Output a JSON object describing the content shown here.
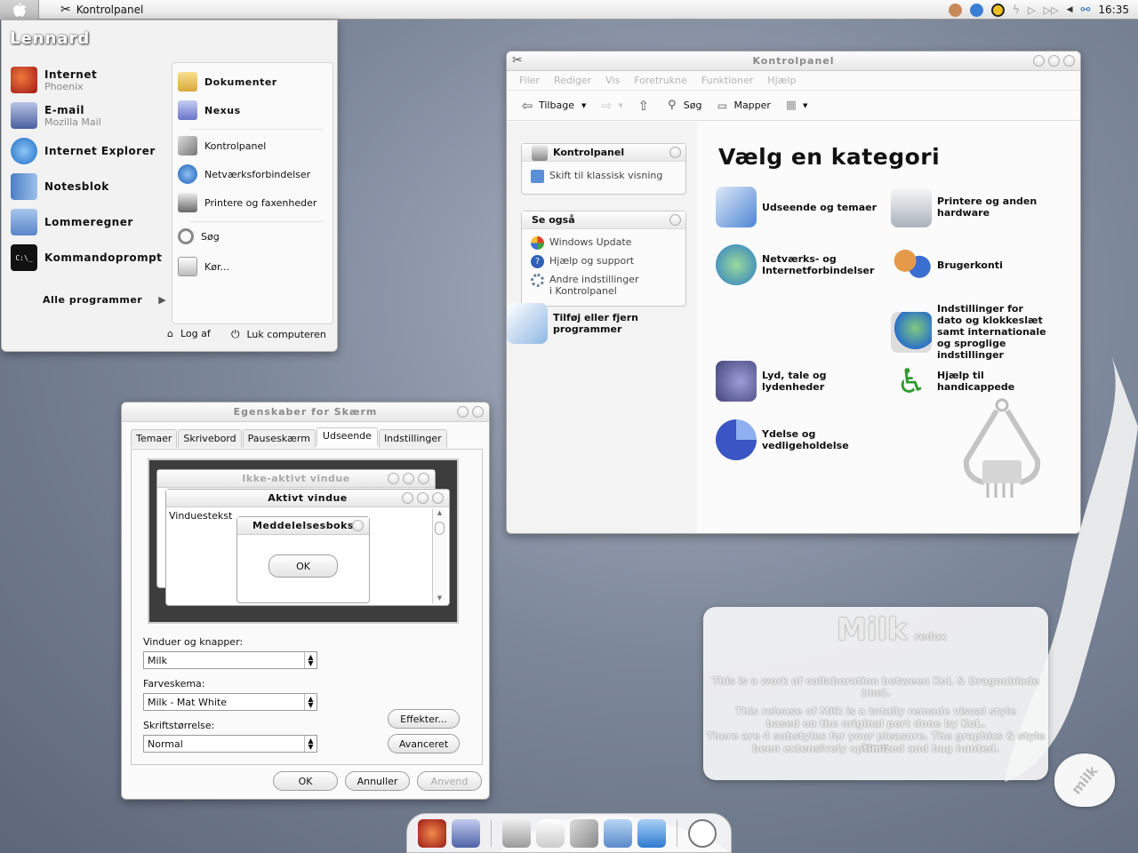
{
  "menubar": {
    "title": "Kontrolpanel",
    "clock": "16:35"
  },
  "startmenu": {
    "user": "Lennard",
    "pinned": [
      {
        "label": "Internet",
        "sub": "Phoenix",
        "icon": "phoenix-browser-icon",
        "color": "#c0392b"
      },
      {
        "label": "E-mail",
        "sub": "Mozilla Mail",
        "icon": "mozilla-mail-icon",
        "color": "#5a6fa8"
      }
    ],
    "recent": [
      {
        "label": "Internet Explorer",
        "icon": "internet-explorer-icon",
        "color": "#2f7fd3"
      },
      {
        "label": "Notesblok",
        "icon": "notepad-icon",
        "color": "#6f9bd8"
      },
      {
        "label": "Lommeregner",
        "icon": "calculator-icon",
        "color": "#7da3d8"
      },
      {
        "label": "Kommandoprompt",
        "icon": "command-prompt-icon",
        "color": "#111111"
      }
    ],
    "all_programs": "Alle programmer",
    "right": [
      {
        "label": "Dokumenter",
        "bold": true,
        "icon": "folder-documents-icon",
        "color": "#e8c35a"
      },
      {
        "label": "Nexus",
        "bold": true,
        "icon": "computer-icon",
        "color": "#8e9be0"
      },
      {
        "label": "Kontrolpanel",
        "icon": "control-panel-tools-icon",
        "color": "#9a9a9a"
      },
      {
        "label": "Netværksforbindelser",
        "icon": "network-globe-icon",
        "color": "#3c7fd6"
      },
      {
        "label": "Printere og faxenheder",
        "icon": "printer-icon",
        "color": "#777777"
      },
      {
        "label": "Søg",
        "icon": "search-magnifier-icon",
        "color": "#cfcfcf"
      },
      {
        "label": "Kør...",
        "icon": "run-icon",
        "color": "#dddddd"
      }
    ],
    "logoff": "Log af",
    "shutdown": "Luk computeren"
  },
  "kontrolpanel": {
    "title": "Kontrolpanel",
    "menu": [
      "Filer",
      "Rediger",
      "Vis",
      "Foretrukne",
      "Funktioner",
      "Hjælp"
    ],
    "toolbar": {
      "back": "Tilbage",
      "search": "Søg",
      "folders": "Mapper"
    },
    "sidepane": {
      "title": "Kontrolpanel",
      "switch": "Skift til klassisk visning",
      "see_also_title": "Se også",
      "see_also": [
        "Windows Update",
        "Hjælp og support",
        "Andre indstillinger i Kontrolpanel"
      ]
    },
    "heading": "Vælg en kategori",
    "categories": [
      {
        "label": "Udseende og temaer",
        "icon": "appearance-themes-icon",
        "color": "#5c8fd6"
      },
      {
        "label": "Printere og anden hardware",
        "icon": "printer-hardware-icon",
        "color": "#aab4c0"
      },
      {
        "label": "Netværks- og Internetforbindelser",
        "icon": "network-internet-icon",
        "color": "#3da03d"
      },
      {
        "label": "Brugerkonti",
        "icon": "user-accounts-icon",
        "color": "#d9822b"
      },
      {
        "label": "Tilføj eller fjern programmer",
        "icon": "add-remove-programs-icon",
        "color": "#6aa6d8"
      },
      {
        "label": "Indstillinger for dato og klokkeslæt samt internationale og sproglige indstillinger",
        "icon": "date-time-region-icon",
        "color": "#4c9a4c"
      },
      {
        "label": "Lyd, tale og lydenheder",
        "icon": "sound-speaker-icon",
        "color": "#6d6db0"
      },
      {
        "label": "Hjælp til handicappede",
        "icon": "accessibility-icon",
        "color": "#2f9a2f"
      },
      {
        "label": "Ydelse og vedligeholdelse",
        "icon": "performance-pie-icon",
        "color": "#4a64c8"
      }
    ]
  },
  "display": {
    "title": "Egenskaber for Skærm",
    "tabs": [
      "Temaer",
      "Skrivebord",
      "Pauseskærm",
      "Udseende",
      "Indstillinger"
    ],
    "preview": {
      "inactive": "Ikke-aktivt vindue",
      "active": "Aktivt vindue",
      "window_text": "Vinduestekst",
      "messagebox": "Meddelelsesboks",
      "ok": "OK"
    },
    "windows_label": "Vinduer og knapper:",
    "windows_value": "Milk",
    "scheme_label": "Farveskema:",
    "scheme_value": "Milk - Mat White",
    "font_label": "Skriftstørrelse:",
    "font_value": "Normal",
    "effects": "Effekter...",
    "advanced": "Avanceret",
    "ok": "OK",
    "cancel": "Annuller",
    "apply": "Anvend"
  },
  "milk": {
    "title": "Milk",
    "subtitle": "redux",
    "line1": "This is a work of collaboration between KoL & Dragonblade (me).",
    "line2": "This release of Milk is a totally remade visual style",
    "line3": "based on the original port done by KoL.",
    "line4": "There are 4 substyles for your pleasure. The graphics & style have",
    "line5": "been extensively optimized and bug hunted.",
    "logo": "milk"
  }
}
